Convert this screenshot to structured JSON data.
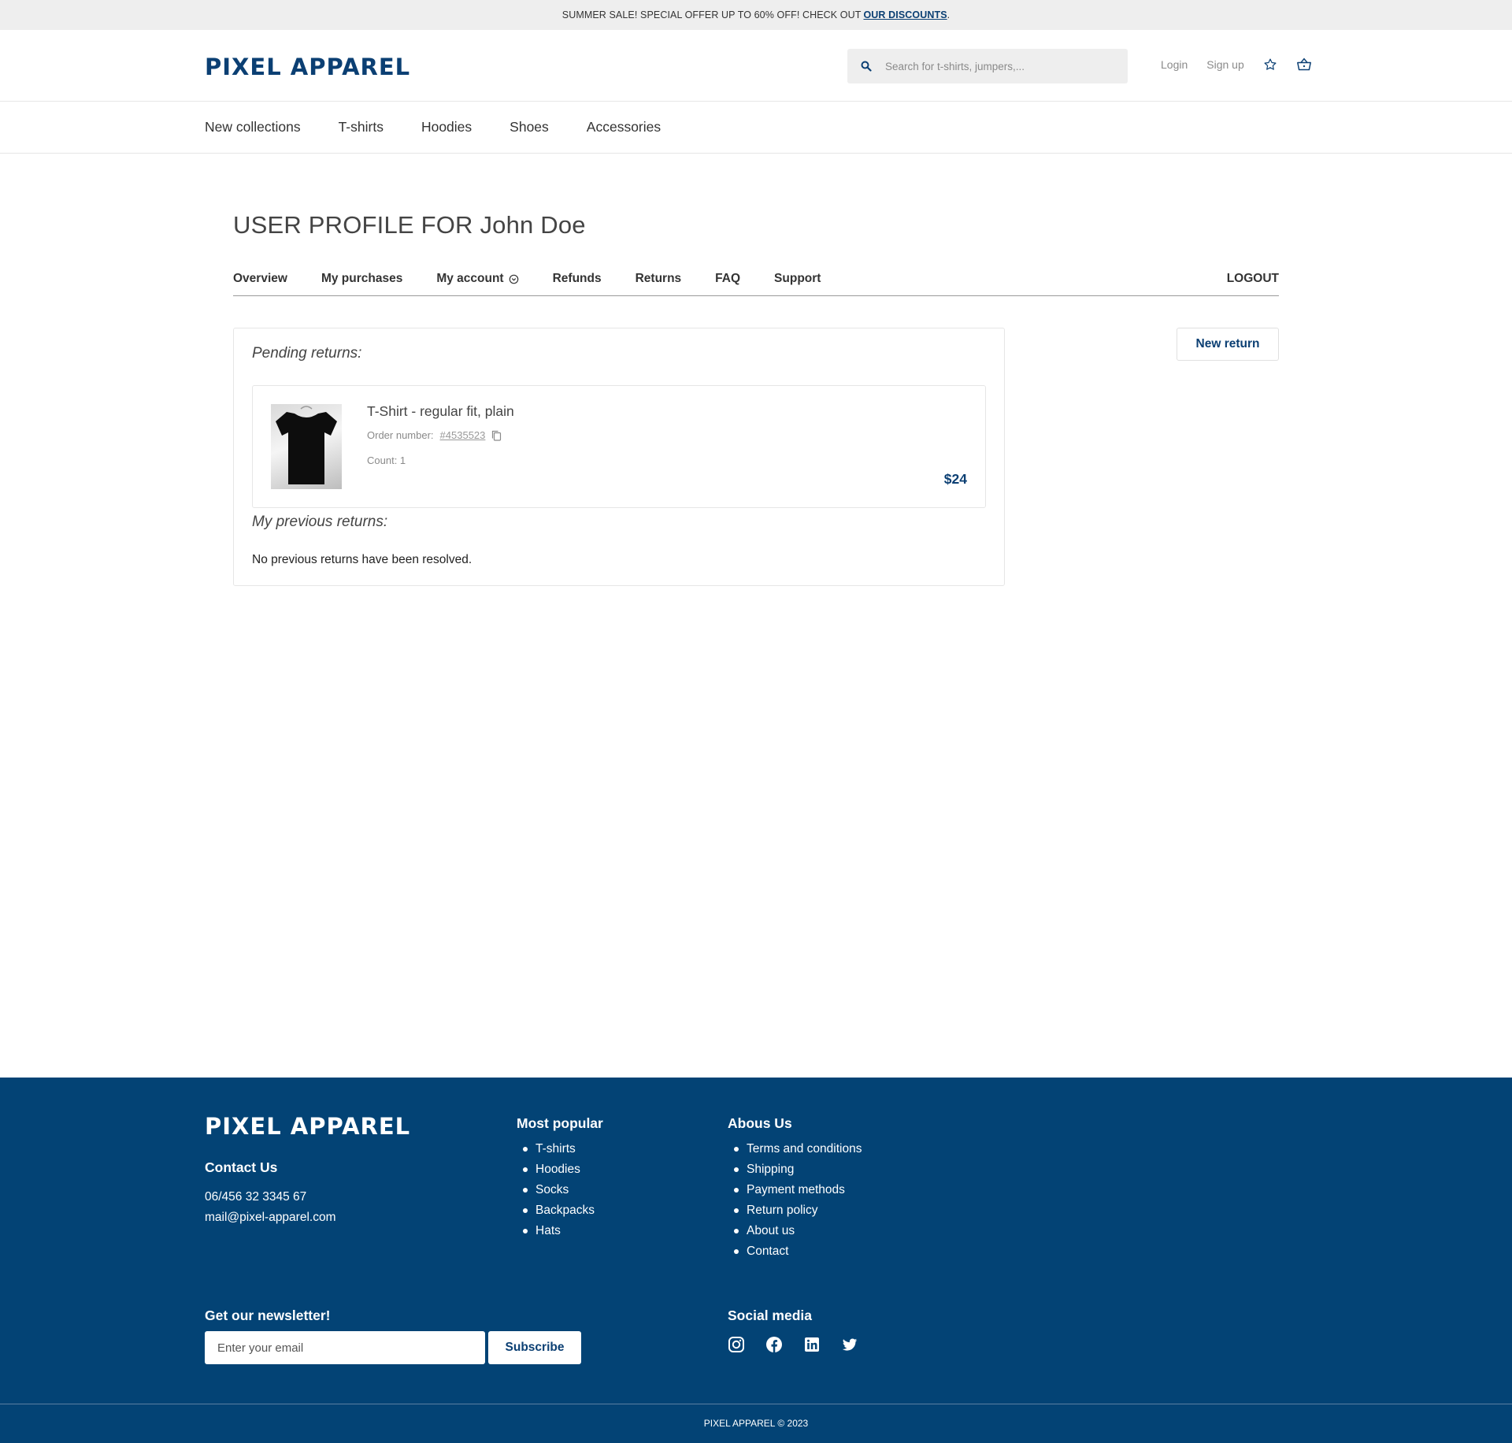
{
  "promo": {
    "text": "SUMMER SALE! SPECIAL OFFER UP TO 60% OFF! CHECK OUT",
    "link": "OUR DISCOUNTS",
    "suffix": "."
  },
  "header": {
    "logo": "PIXEL APPAREL",
    "search_placeholder": "Search for t-shirts, jumpers,...",
    "login": "Login",
    "signup": "Sign up",
    "icons": [
      "search-icon",
      "star-icon",
      "basket-icon"
    ]
  },
  "nav": {
    "items": [
      "New collections",
      "T-shirts",
      "Hoodies",
      "Shoes",
      "Accessories"
    ]
  },
  "profile": {
    "title": "USER PROFILE FOR John Doe",
    "tabs": [
      "Overview",
      "My purchases",
      "My account",
      "Refunds",
      "Returns",
      "FAQ",
      "Support"
    ],
    "logout": "LOGOUT"
  },
  "returns": {
    "pending_heading": "Pending returns:",
    "item": {
      "name": "T-Shirt - regular fit, plain",
      "order_label": "Order number:",
      "order_number": "#4535523",
      "count": "Count: 1",
      "price": "$24"
    },
    "previous_heading": "My previous returns:",
    "previous_empty": "No previous returns have been resolved.",
    "new_return": "New return"
  },
  "footer": {
    "logo": "PIXEL APPAREL",
    "contact_heading": "Contact Us",
    "phone": "06/456 32 3345 67",
    "email": "mail@pixel-apparel.com",
    "popular_heading": "Most popular",
    "popular": [
      "T-shirts",
      "Hoodies",
      "Socks",
      "Backpacks",
      "Hats"
    ],
    "about_heading": "Abous Us",
    "about": [
      "Terms and conditions",
      "Shipping",
      "Payment methods",
      "Return policy",
      "About us",
      "Contact"
    ],
    "newsletter_heading": "Get our newsletter!",
    "email_placeholder": "Enter your email",
    "subscribe": "Subscribe",
    "social_heading": "Social media",
    "social_icons": [
      "instagram-icon",
      "facebook-icon",
      "linkedin-icon",
      "twitter-icon"
    ],
    "copyright": "PIXEL APPAREL © 2023"
  },
  "colors": {
    "brand": "#0b3f73",
    "footer_bg": "#034375",
    "promo_bg": "#eeeeee"
  }
}
